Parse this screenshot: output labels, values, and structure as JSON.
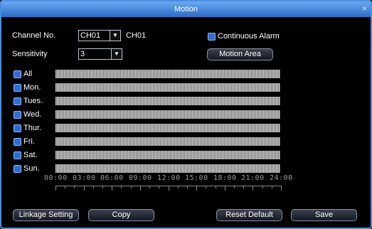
{
  "window": {
    "title": "Motion",
    "close_glyph": "×"
  },
  "channel": {
    "label": "Channel No.",
    "selected": "CH01",
    "name_display": "CH01"
  },
  "sensitivity": {
    "label": "Sensitivity",
    "selected": "3"
  },
  "continuous_alarm": {
    "label": "Continuous Alarm",
    "checked": true
  },
  "motion_area_button": "Motion Area",
  "days": [
    {
      "label": "All",
      "checked": true
    },
    {
      "label": "Mon.",
      "checked": true
    },
    {
      "label": "Tues.",
      "checked": true
    },
    {
      "label": "Wed.",
      "checked": true
    },
    {
      "label": "Thur.",
      "checked": true
    },
    {
      "label": "Fri.",
      "checked": true
    },
    {
      "label": "Sat.",
      "checked": true
    },
    {
      "label": "Sun.",
      "checked": true
    }
  ],
  "timeline": {
    "ticks": [
      "00:00",
      "03:00",
      "06:00",
      "09:00",
      "12:00",
      "15:00",
      "18:00",
      "21:00",
      "24:00"
    ]
  },
  "buttons": {
    "linkage": "Linkage Setting",
    "copy": "Copy",
    "reset": "Reset Default",
    "save": "Save"
  },
  "colors": {
    "accent": "#2b6fd6",
    "title_bar": "#4a8ee0"
  }
}
